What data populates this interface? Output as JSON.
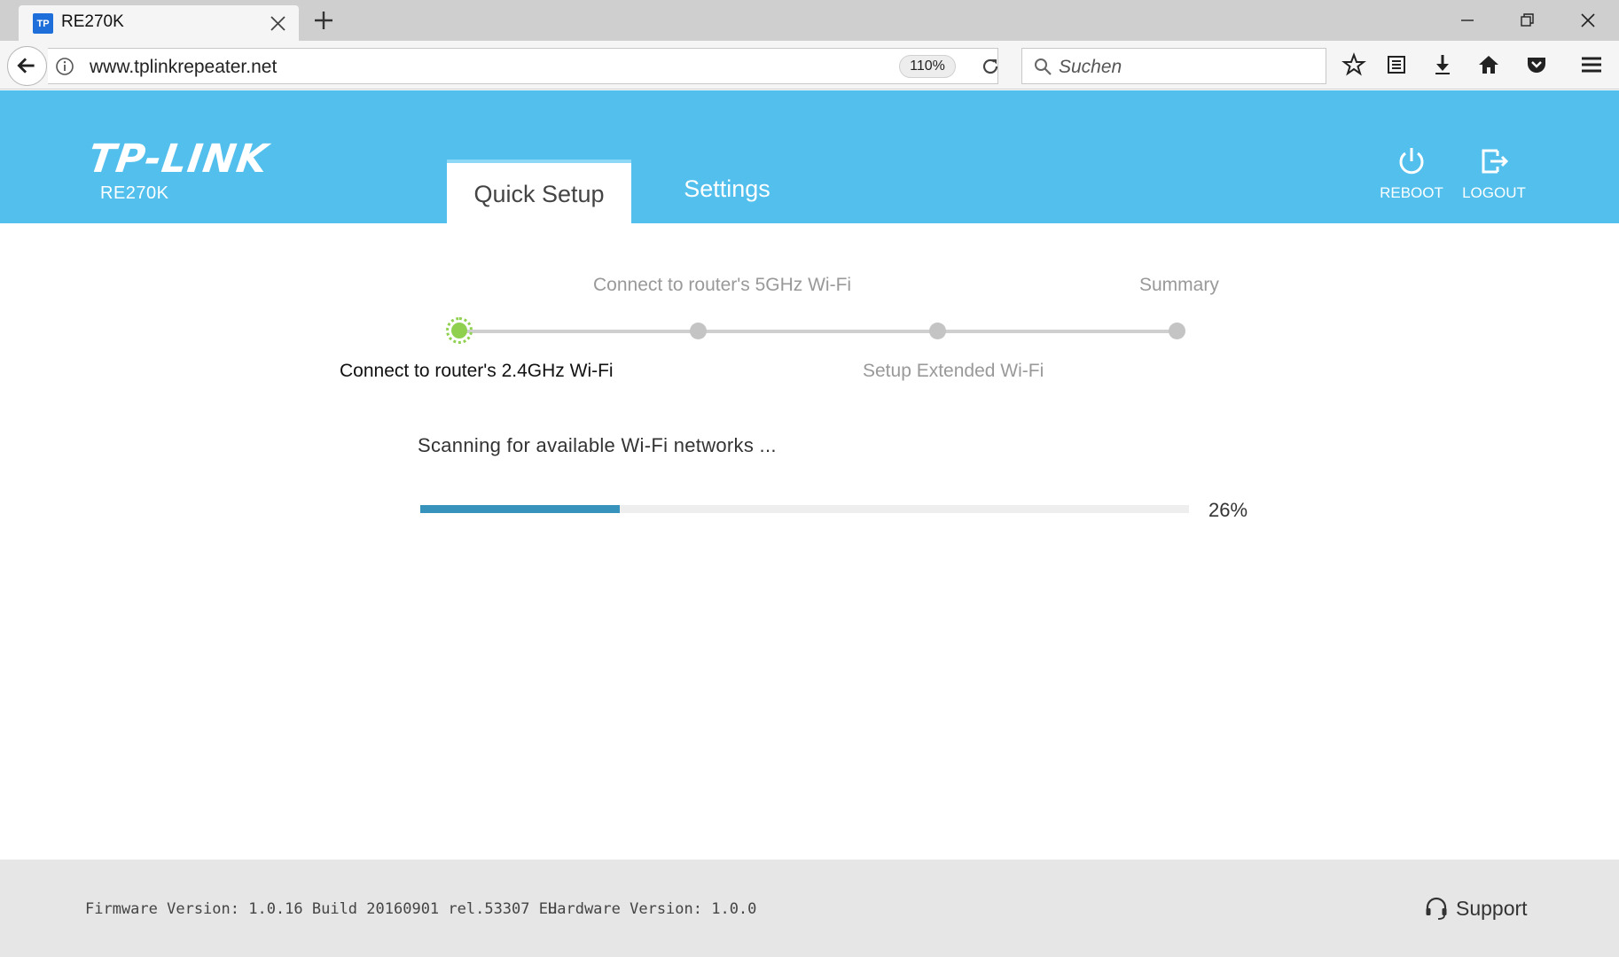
{
  "browser": {
    "tab_title": "RE270K",
    "favicon_text": "TP",
    "url": "www.tplinkrepeater.net",
    "zoom": "110%",
    "search_placeholder": "Suchen"
  },
  "header": {
    "logo": "TP-LINK",
    "model": "RE270K",
    "tabs": [
      {
        "label": "Quick Setup",
        "active": true
      },
      {
        "label": "Settings",
        "active": false
      }
    ],
    "reboot_label": "REBOOT",
    "logout_label": "LOGOUT"
  },
  "wizard": {
    "steps": [
      {
        "label": "Connect to router's 2.4GHz Wi-Fi",
        "active": true
      },
      {
        "label": "Connect to router's 5GHz Wi-Fi",
        "active": false
      },
      {
        "label": "Setup Extended Wi-Fi",
        "active": false
      },
      {
        "label": "Summary",
        "active": false
      }
    ],
    "status_text": "Scanning for available Wi-Fi networks ...",
    "progress_percent": 26,
    "progress_label": "26%"
  },
  "footer": {
    "firmware": "Firmware Version: 1.0.16 Build 20160901 rel.53307 EU",
    "hardware": "Hardware Version: 1.0.0",
    "support_label": "Support"
  },
  "colors": {
    "header_bg": "#52bfed",
    "progress_fill": "#3793bb",
    "active_step": "#8fd14f"
  }
}
